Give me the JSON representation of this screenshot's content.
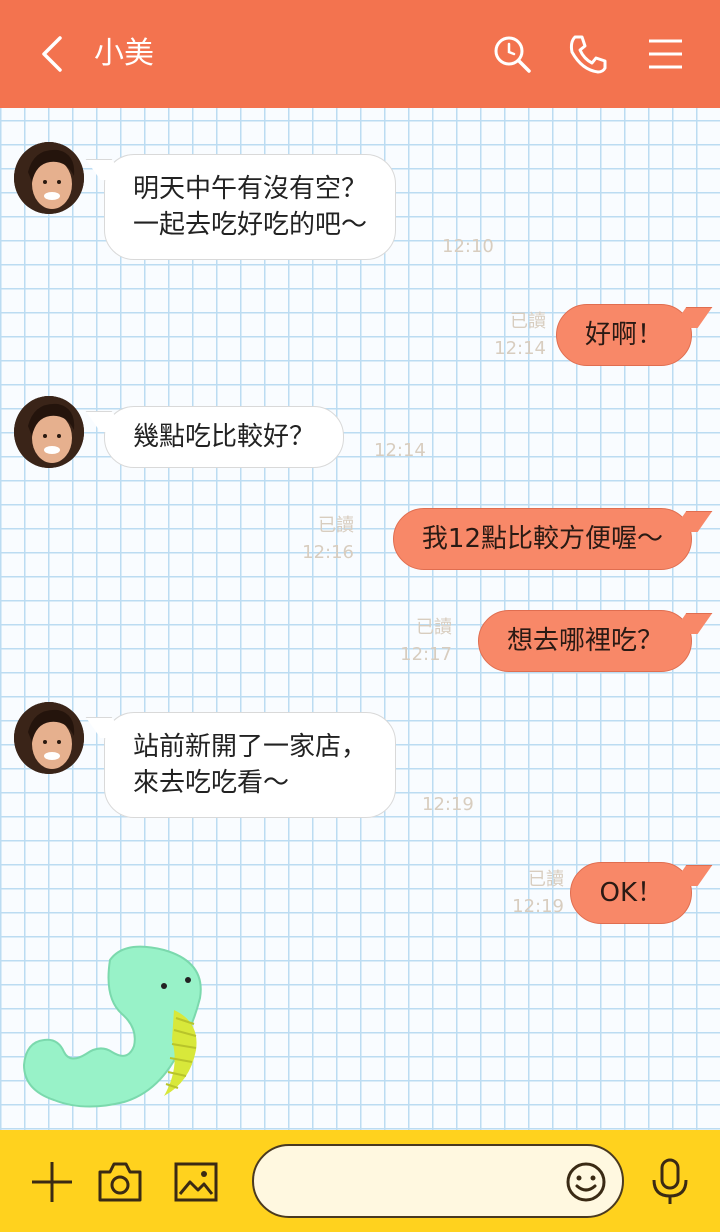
{
  "header": {
    "contact_name": "小美",
    "icons": [
      "back-icon",
      "search-icon",
      "phone-icon",
      "menu-icon"
    ],
    "bg_color": "#f3734f"
  },
  "messages": [
    {
      "side": "in",
      "text": "明天中午有沒有空？\n一起去吃好吃的吧～",
      "time": "12:10"
    },
    {
      "side": "out",
      "text": "好啊！",
      "read": "已讀",
      "time": "12:14"
    },
    {
      "side": "in",
      "text": "幾點吃比較好？",
      "time": "12:14"
    },
    {
      "side": "out",
      "text": "我12點比較方便喔～",
      "read": "已讀",
      "time": "12:16"
    },
    {
      "side": "out",
      "text": "想去哪裡吃？",
      "read": "已讀",
      "time": "12:17"
    },
    {
      "side": "in",
      "text": "站前新開了一家店，\n來去吃吃看～",
      "time": "12:19"
    },
    {
      "side": "out",
      "text": "OK！",
      "read": "已讀",
      "time": "12:19"
    }
  ],
  "sticker": {
    "name": "snake-sticker"
  },
  "composer": {
    "placeholder": "",
    "icons": [
      "plus-icon",
      "camera-icon",
      "image-icon",
      "emoji-icon",
      "microphone-icon"
    ],
    "bg_color": "#ffd21e"
  }
}
